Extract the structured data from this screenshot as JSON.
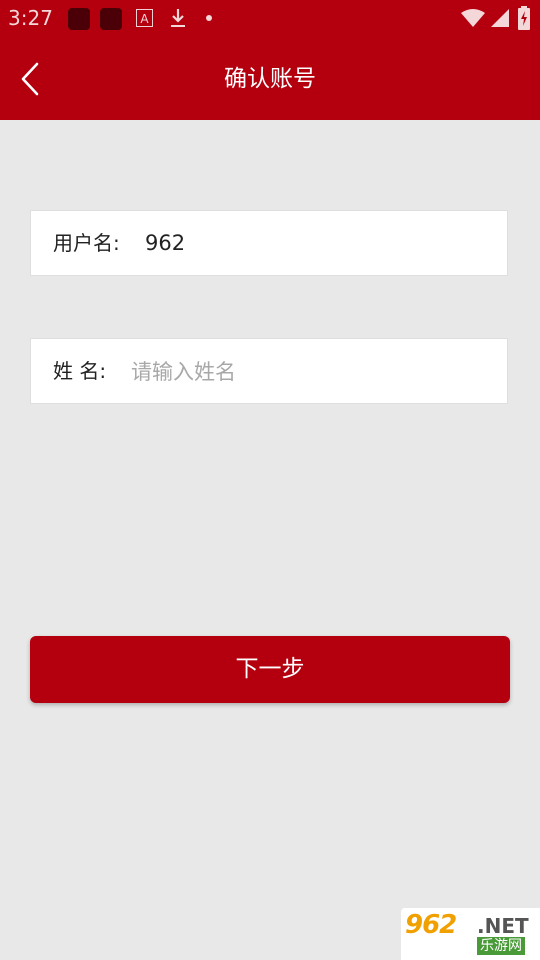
{
  "status_bar": {
    "time": "3:27",
    "notification_letter": "A"
  },
  "header": {
    "title": "确认账号"
  },
  "form": {
    "username_label": "用户名:",
    "username_value": "962",
    "name_label": "姓 名:",
    "name_placeholder": "请输入姓名"
  },
  "actions": {
    "next_label": "下一步"
  },
  "watermark": {
    "brand": "962",
    "domain": ".NET",
    "tagline": "乐游网"
  },
  "colors": {
    "brand_red": "#b4000e",
    "background": "#e8e8e8",
    "placeholder": "#a8a8a8"
  },
  "icons": [
    "chevron-left-icon",
    "wifi-icon",
    "signal-icon",
    "battery-icon",
    "download-icon"
  ]
}
